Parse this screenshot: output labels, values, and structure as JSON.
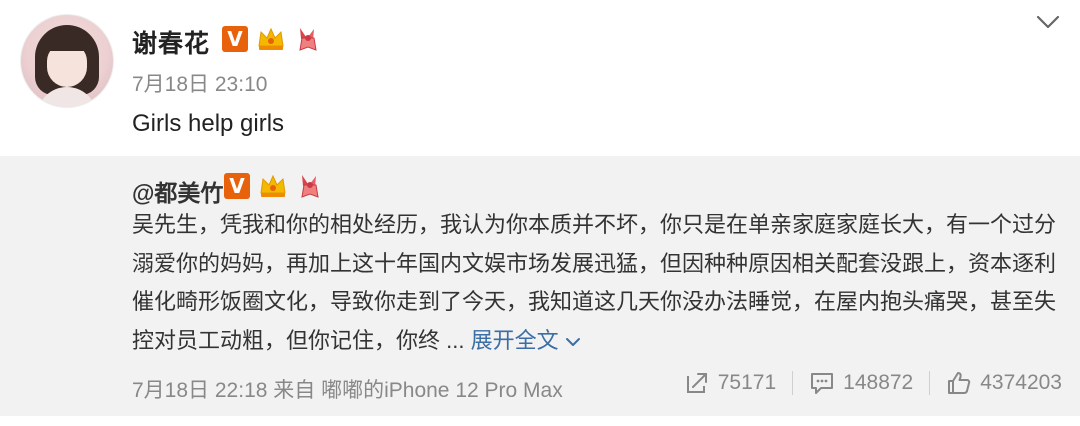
{
  "post": {
    "author": "谢春花",
    "time": "7月18日 23:10",
    "content": "Girls help girls",
    "badges": [
      "verified-v-icon",
      "crown-icon",
      "ribbon-icon"
    ],
    "vbadge_letter": "V"
  },
  "repost": {
    "author": "@都美竹",
    "text": "吴先生，凭我和你的相处经历，我认为你本质并不坏，你只是在单亲家庭家庭长大，有一个过分溺爱你的妈妈，再加上这十年国内文娱市场发展迅猛，但因种种原因相关配套没跟上，资本逐利催化畸形饭圈文化，导致你走到了今天，我知道这几天你没办法睡觉，在屋内抱头痛哭，甚至失控对员工动粗，但你记住，你终 ...",
    "expand_label": "展开全文",
    "meta": "7月18日 22:18 来自 嘟嘟的iPhone 12 Pro Max",
    "reposts": "75171",
    "comments": "148872",
    "likes": "4374203",
    "vbadge_letter": "V"
  },
  "colors": {
    "accent_link": "#3a6ea5",
    "verified_orange": "#e8620c",
    "repost_bg": "#f2f2f2"
  }
}
